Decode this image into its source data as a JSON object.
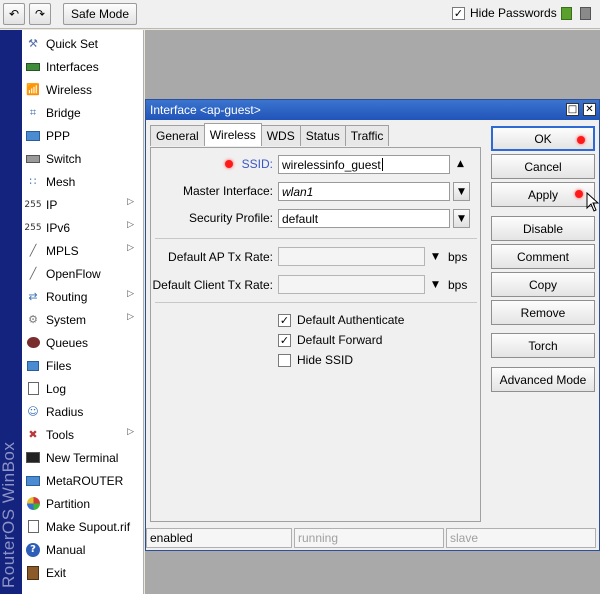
{
  "toolbar": {
    "undo_icon": "undo-icon",
    "redo_icon": "redo-icon",
    "safe_mode_label": "Safe Mode",
    "hide_passwords_label": "Hide Passwords",
    "hide_passwords_checked": true
  },
  "brand": {
    "text": "RouterOS WinBox"
  },
  "menu": {
    "items": [
      {
        "label": "Quick Set",
        "icon": "quick-set-icon",
        "submenu": false
      },
      {
        "label": "Interfaces",
        "icon": "interfaces-icon",
        "submenu": false
      },
      {
        "label": "Wireless",
        "icon": "wireless-icon",
        "submenu": false
      },
      {
        "label": "Bridge",
        "icon": "bridge-icon",
        "submenu": false
      },
      {
        "label": "PPP",
        "icon": "ppp-icon",
        "submenu": false
      },
      {
        "label": "Switch",
        "icon": "switch-icon",
        "submenu": false
      },
      {
        "label": "Mesh",
        "icon": "mesh-icon",
        "submenu": false
      },
      {
        "label": "IP",
        "icon": "ip-icon",
        "submenu": true
      },
      {
        "label": "IPv6",
        "icon": "ipv6-icon",
        "submenu": true
      },
      {
        "label": "MPLS",
        "icon": "mpls-icon",
        "submenu": true
      },
      {
        "label": "OpenFlow",
        "icon": "openflow-icon",
        "submenu": false
      },
      {
        "label": "Routing",
        "icon": "routing-icon",
        "submenu": true
      },
      {
        "label": "System",
        "icon": "system-icon",
        "submenu": true
      },
      {
        "label": "Queues",
        "icon": "queues-icon",
        "submenu": false
      },
      {
        "label": "Files",
        "icon": "files-icon",
        "submenu": false
      },
      {
        "label": "Log",
        "icon": "log-icon",
        "submenu": false
      },
      {
        "label": "Radius",
        "icon": "radius-icon",
        "submenu": false
      },
      {
        "label": "Tools",
        "icon": "tools-icon",
        "submenu": true
      },
      {
        "label": "New Terminal",
        "icon": "terminal-icon",
        "submenu": false
      },
      {
        "label": "MetaROUTER",
        "icon": "metarouter-icon",
        "submenu": false
      },
      {
        "label": "Partition",
        "icon": "partition-icon",
        "submenu": false
      },
      {
        "label": "Make Supout.rif",
        "icon": "supout-icon",
        "submenu": false
      },
      {
        "label": "Manual",
        "icon": "manual-icon",
        "submenu": false
      },
      {
        "label": "Exit",
        "icon": "exit-icon",
        "submenu": false
      }
    ]
  },
  "dialog": {
    "title": "Interface <ap-guest>",
    "tabs": [
      {
        "label": "General",
        "active": false
      },
      {
        "label": "Wireless",
        "active": true
      },
      {
        "label": "WDS",
        "active": false
      },
      {
        "label": "Status",
        "active": false
      },
      {
        "label": "Traffic",
        "active": false
      }
    ],
    "form": {
      "ssid_label": "SSID:",
      "ssid_value": "wirelessinfo_guest",
      "master_label": "Master Interface:",
      "master_value": "wlan1",
      "security_label": "Security Profile:",
      "security_value": "default",
      "ap_tx_label": "Default AP Tx Rate:",
      "ap_tx_value": "",
      "ap_tx_unit": "bps",
      "client_tx_label": "Default Client Tx Rate:",
      "client_tx_value": "",
      "client_tx_unit": "bps",
      "default_authenticate_label": "Default Authenticate",
      "default_authenticate_checked": true,
      "default_forward_label": "Default Forward",
      "default_forward_checked": true,
      "hide_ssid_label": "Hide SSID",
      "hide_ssid_checked": false
    },
    "actions": {
      "ok": "OK",
      "cancel": "Cancel",
      "apply": "Apply",
      "disable": "Disable",
      "comment": "Comment",
      "copy": "Copy",
      "remove": "Remove",
      "torch": "Torch",
      "advanced": "Advanced Mode"
    },
    "status": {
      "enabled": "enabled",
      "running": "running",
      "slave": "slave"
    }
  },
  "colors": {
    "brand_band": "#13237e",
    "titlebar": "#2154b8",
    "workspace": "#a9a9a9",
    "highlight_dot": "#ff1a1a"
  }
}
